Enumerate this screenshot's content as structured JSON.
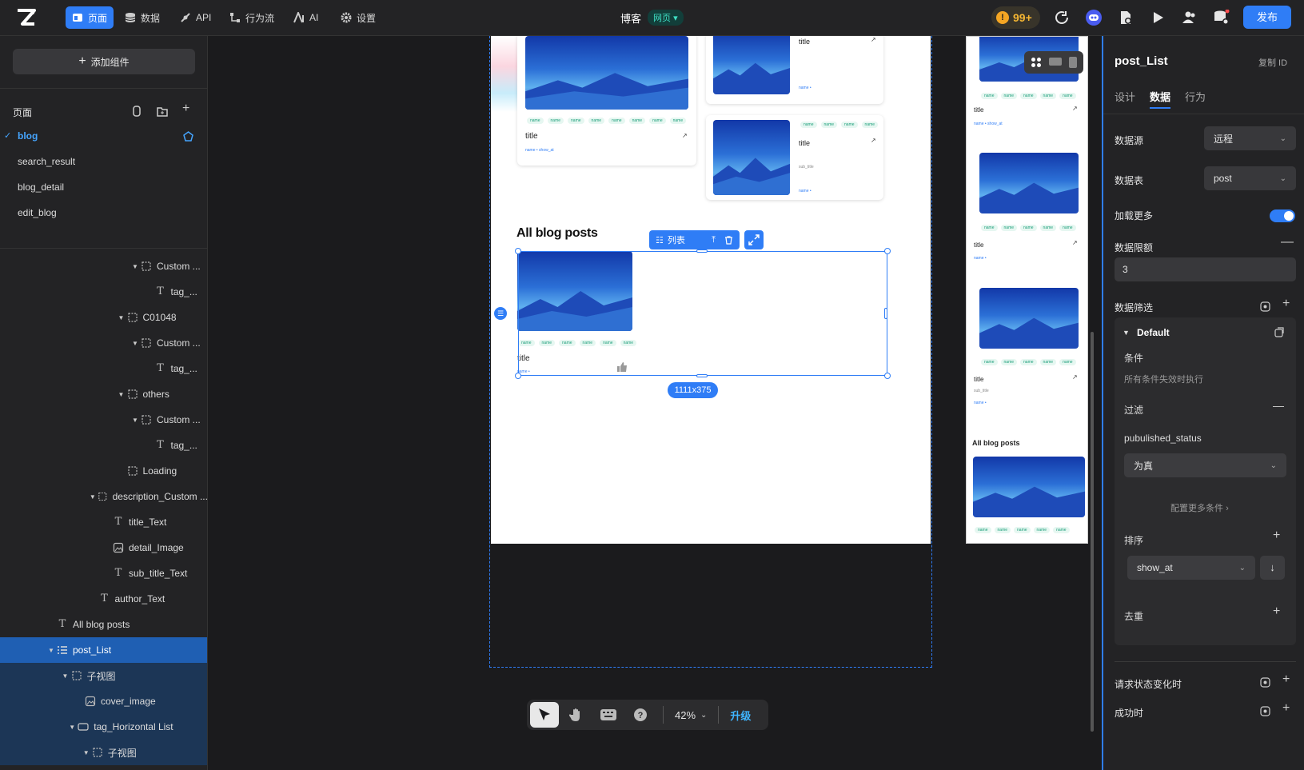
{
  "topbar": {
    "nav": [
      {
        "label": "页面",
        "icon": "page-icon"
      },
      {
        "label": "数据",
        "icon": "database-icon"
      },
      {
        "label": "API",
        "icon": "api-icon"
      },
      {
        "label": "行为流",
        "icon": "flow-icon"
      },
      {
        "label": "AI",
        "icon": "ai-icon"
      },
      {
        "label": "设置",
        "icon": "gear-icon"
      }
    ],
    "app_name": "博客",
    "app_type": "网页",
    "warning_count": "99+",
    "publish": "发布"
  },
  "sidebar": {
    "add_component": "添加组件",
    "pages_title": "页面",
    "pages": [
      "blog",
      "search_result",
      "blog_detail",
      "edit_blog"
    ],
    "tree": [
      {
        "label": "Custom ...",
        "indent": 8,
        "caret": true,
        "icon": "frame"
      },
      {
        "label": "tag_...",
        "indent": 9,
        "caret": false,
        "icon": "text"
      },
      {
        "label": "C01048",
        "indent": 7,
        "caret": true,
        "icon": "frame"
      },
      {
        "label": "Custom ...",
        "indent": 8,
        "caret": true,
        "icon": "frame"
      },
      {
        "label": "tag_...",
        "indent": 9,
        "caret": false,
        "icon": "text"
      },
      {
        "label": "others",
        "indent": 7,
        "caret": true,
        "icon": "frame"
      },
      {
        "label": "Custom ...",
        "indent": 8,
        "caret": true,
        "icon": "frame"
      },
      {
        "label": "tag_...",
        "indent": 9,
        "caret": false,
        "icon": "text"
      },
      {
        "label": "Loading",
        "indent": 7,
        "caret": false,
        "icon": "frame"
      },
      {
        "label": "description_Custom ...",
        "indent": 5,
        "caret": true,
        "icon": "frame"
      },
      {
        "label": "title_Text",
        "indent": 6,
        "caret": false,
        "icon": "text"
      },
      {
        "label": "detail_Image",
        "indent": 6,
        "caret": false,
        "icon": "image"
      },
      {
        "label": "sub_title_Text",
        "indent": 6,
        "caret": false,
        "icon": "text"
      },
      {
        "label": "author_Text",
        "indent": 5,
        "caret": false,
        "icon": "text"
      },
      {
        "label": "All blog posts",
        "indent": 2,
        "caret": false,
        "icon": "text"
      },
      {
        "label": "post_List",
        "indent": 2,
        "caret": true,
        "icon": "list",
        "state": "sel"
      },
      {
        "label": "子视图",
        "indent": 3,
        "caret": true,
        "icon": "frame",
        "state": "child"
      },
      {
        "label": "cover_image",
        "indent": 4,
        "caret": false,
        "icon": "image",
        "state": "child"
      },
      {
        "label": "tag_Horizontal List",
        "indent": 3.5,
        "caret": true,
        "icon": "hlist",
        "state": "child"
      },
      {
        "label": "子视图",
        "indent": 4.5,
        "caret": true,
        "icon": "frame",
        "state": "child"
      }
    ]
  },
  "canvas": {
    "tag": "name",
    "card_title": "title",
    "meta": "name • show_at",
    "meta_short": "name •",
    "sub_title": "sub_title",
    "section_heading": "All blog posts",
    "list_toolbar_label": "列表",
    "size_badge": "1111x375",
    "zoom": "42%",
    "upgrade": "升级"
  },
  "panel": {
    "title": "post_List",
    "copy_id": "复制 ID",
    "tabs": [
      "设计",
      "数据",
      "行为"
    ],
    "active_tab": "数据",
    "datasource_label": "数据源",
    "datasource_value": "远程",
    "table_label": "数据表",
    "table_value": "post",
    "load_more_label": "加载更多",
    "load_more_on": true,
    "limit_label": "数据限额",
    "limit_value": "3",
    "filter_label": "数据筛选",
    "filter_group": "Default",
    "condition_label": "条件",
    "condition_desc": "所有条件失效时执行",
    "filter_sub_label": "过滤",
    "filter_field": "pubulished_status",
    "filter_op": "为真",
    "more_conditions": "配置更多条件",
    "sort_label": "排序",
    "sort_field": "show_at",
    "dedupe_label": "去重",
    "on_request_change": "请求状态变化时",
    "on_success": "成功时"
  }
}
